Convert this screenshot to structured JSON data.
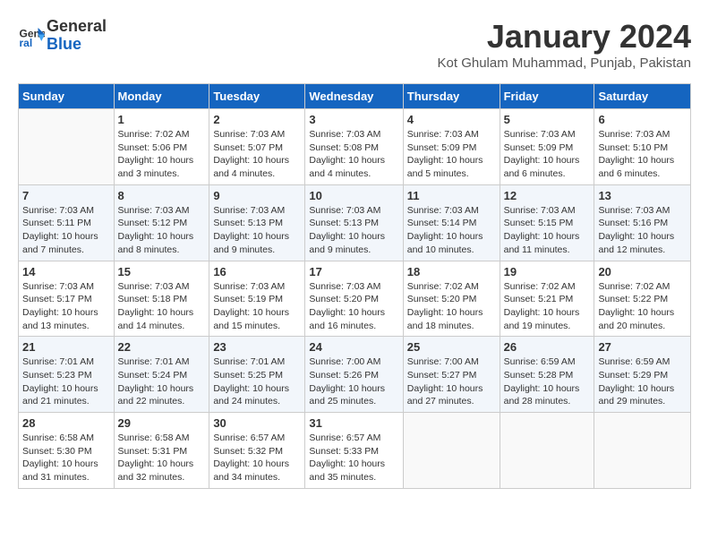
{
  "logo": {
    "line1": "General",
    "line2": "Blue"
  },
  "title": "January 2024",
  "location": "Kot Ghulam Muhammad, Punjab, Pakistan",
  "days_of_week": [
    "Sunday",
    "Monday",
    "Tuesday",
    "Wednesday",
    "Thursday",
    "Friday",
    "Saturday"
  ],
  "weeks": [
    [
      {
        "day": "",
        "info": ""
      },
      {
        "day": "1",
        "info": "Sunrise: 7:02 AM\nSunset: 5:06 PM\nDaylight: 10 hours\nand 3 minutes."
      },
      {
        "day": "2",
        "info": "Sunrise: 7:03 AM\nSunset: 5:07 PM\nDaylight: 10 hours\nand 4 minutes."
      },
      {
        "day": "3",
        "info": "Sunrise: 7:03 AM\nSunset: 5:08 PM\nDaylight: 10 hours\nand 4 minutes."
      },
      {
        "day": "4",
        "info": "Sunrise: 7:03 AM\nSunset: 5:09 PM\nDaylight: 10 hours\nand 5 minutes."
      },
      {
        "day": "5",
        "info": "Sunrise: 7:03 AM\nSunset: 5:09 PM\nDaylight: 10 hours\nand 6 minutes."
      },
      {
        "day": "6",
        "info": "Sunrise: 7:03 AM\nSunset: 5:10 PM\nDaylight: 10 hours\nand 6 minutes."
      }
    ],
    [
      {
        "day": "7",
        "info": "Sunrise: 7:03 AM\nSunset: 5:11 PM\nDaylight: 10 hours\nand 7 minutes."
      },
      {
        "day": "8",
        "info": "Sunrise: 7:03 AM\nSunset: 5:12 PM\nDaylight: 10 hours\nand 8 minutes."
      },
      {
        "day": "9",
        "info": "Sunrise: 7:03 AM\nSunset: 5:13 PM\nDaylight: 10 hours\nand 9 minutes."
      },
      {
        "day": "10",
        "info": "Sunrise: 7:03 AM\nSunset: 5:13 PM\nDaylight: 10 hours\nand 9 minutes."
      },
      {
        "day": "11",
        "info": "Sunrise: 7:03 AM\nSunset: 5:14 PM\nDaylight: 10 hours\nand 10 minutes."
      },
      {
        "day": "12",
        "info": "Sunrise: 7:03 AM\nSunset: 5:15 PM\nDaylight: 10 hours\nand 11 minutes."
      },
      {
        "day": "13",
        "info": "Sunrise: 7:03 AM\nSunset: 5:16 PM\nDaylight: 10 hours\nand 12 minutes."
      }
    ],
    [
      {
        "day": "14",
        "info": "Sunrise: 7:03 AM\nSunset: 5:17 PM\nDaylight: 10 hours\nand 13 minutes."
      },
      {
        "day": "15",
        "info": "Sunrise: 7:03 AM\nSunset: 5:18 PM\nDaylight: 10 hours\nand 14 minutes."
      },
      {
        "day": "16",
        "info": "Sunrise: 7:03 AM\nSunset: 5:19 PM\nDaylight: 10 hours\nand 15 minutes."
      },
      {
        "day": "17",
        "info": "Sunrise: 7:03 AM\nSunset: 5:20 PM\nDaylight: 10 hours\nand 16 minutes."
      },
      {
        "day": "18",
        "info": "Sunrise: 7:02 AM\nSunset: 5:20 PM\nDaylight: 10 hours\nand 18 minutes."
      },
      {
        "day": "19",
        "info": "Sunrise: 7:02 AM\nSunset: 5:21 PM\nDaylight: 10 hours\nand 19 minutes."
      },
      {
        "day": "20",
        "info": "Sunrise: 7:02 AM\nSunset: 5:22 PM\nDaylight: 10 hours\nand 20 minutes."
      }
    ],
    [
      {
        "day": "21",
        "info": "Sunrise: 7:01 AM\nSunset: 5:23 PM\nDaylight: 10 hours\nand 21 minutes."
      },
      {
        "day": "22",
        "info": "Sunrise: 7:01 AM\nSunset: 5:24 PM\nDaylight: 10 hours\nand 22 minutes."
      },
      {
        "day": "23",
        "info": "Sunrise: 7:01 AM\nSunset: 5:25 PM\nDaylight: 10 hours\nand 24 minutes."
      },
      {
        "day": "24",
        "info": "Sunrise: 7:00 AM\nSunset: 5:26 PM\nDaylight: 10 hours\nand 25 minutes."
      },
      {
        "day": "25",
        "info": "Sunrise: 7:00 AM\nSunset: 5:27 PM\nDaylight: 10 hours\nand 27 minutes."
      },
      {
        "day": "26",
        "info": "Sunrise: 6:59 AM\nSunset: 5:28 PM\nDaylight: 10 hours\nand 28 minutes."
      },
      {
        "day": "27",
        "info": "Sunrise: 6:59 AM\nSunset: 5:29 PM\nDaylight: 10 hours\nand 29 minutes."
      }
    ],
    [
      {
        "day": "28",
        "info": "Sunrise: 6:58 AM\nSunset: 5:30 PM\nDaylight: 10 hours\nand 31 minutes."
      },
      {
        "day": "29",
        "info": "Sunrise: 6:58 AM\nSunset: 5:31 PM\nDaylight: 10 hours\nand 32 minutes."
      },
      {
        "day": "30",
        "info": "Sunrise: 6:57 AM\nSunset: 5:32 PM\nDaylight: 10 hours\nand 34 minutes."
      },
      {
        "day": "31",
        "info": "Sunrise: 6:57 AM\nSunset: 5:33 PM\nDaylight: 10 hours\nand 35 minutes."
      },
      {
        "day": "",
        "info": ""
      },
      {
        "day": "",
        "info": ""
      },
      {
        "day": "",
        "info": ""
      }
    ]
  ]
}
